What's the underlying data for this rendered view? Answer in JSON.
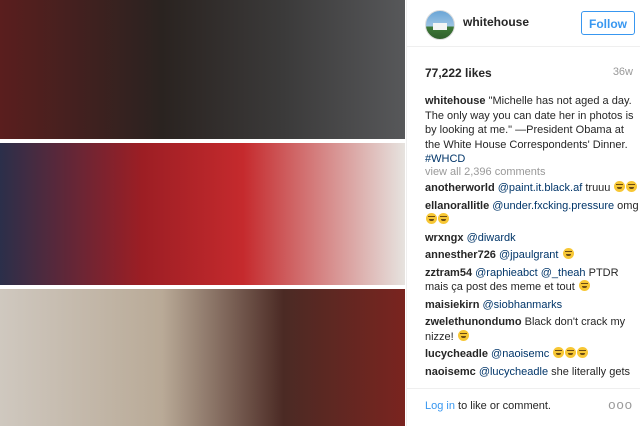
{
  "post": {
    "username": "whitehouse",
    "follow_label": "Follow",
    "likes": "77,222 likes",
    "time": "36w",
    "caption": {
      "user": "whitehouse",
      "text": "\"Michelle has not aged a day. The only way you can date her in photos is by looking at me.\" —President Obama at the White House Correspondents' Dinner.",
      "hashtag": "#WHCD"
    },
    "view_all": "view all 2,396 comments",
    "comments": [
      {
        "user": "anotherworld",
        "mention": "@paint.it.black.af",
        "text": "truuu",
        "emoji": 2
      },
      {
        "user": "ellanorallitle",
        "mention": "@under.fxcking.pressure",
        "text": "omg",
        "emoji": 2
      },
      {
        "user": "wrxngx",
        "mention": "@diwardk",
        "text": "",
        "emoji": 0
      },
      {
        "user": "annesther726",
        "mention": "@jpaulgrant",
        "text": "",
        "emoji": 1
      },
      {
        "user": "zztram54",
        "mention": "@raphieabct @_theah",
        "text": "PTDR mais ça post des meme et tout",
        "emoji": 1
      },
      {
        "user": "maisiekirn",
        "mention": "@siobhanmarks",
        "text": "",
        "emoji": 0
      },
      {
        "user": "zwelethunondumo",
        "mention": "",
        "text": "Black don't crack my nizze!",
        "emoji": 1
      },
      {
        "user": "lucycheadle",
        "mention": "@naoisemc",
        "text": "",
        "emoji": 3
      },
      {
        "user": "naoisemc",
        "mention": "@lucycheadle",
        "text": "she literally gets",
        "emoji": 0
      }
    ],
    "login_link": "Log in",
    "login_text": " to like or comment.",
    "more": "ooo"
  },
  "icons": {
    "emoji": "face-with-tears-of-joy-icon",
    "avatar": "white-house-avatar"
  }
}
